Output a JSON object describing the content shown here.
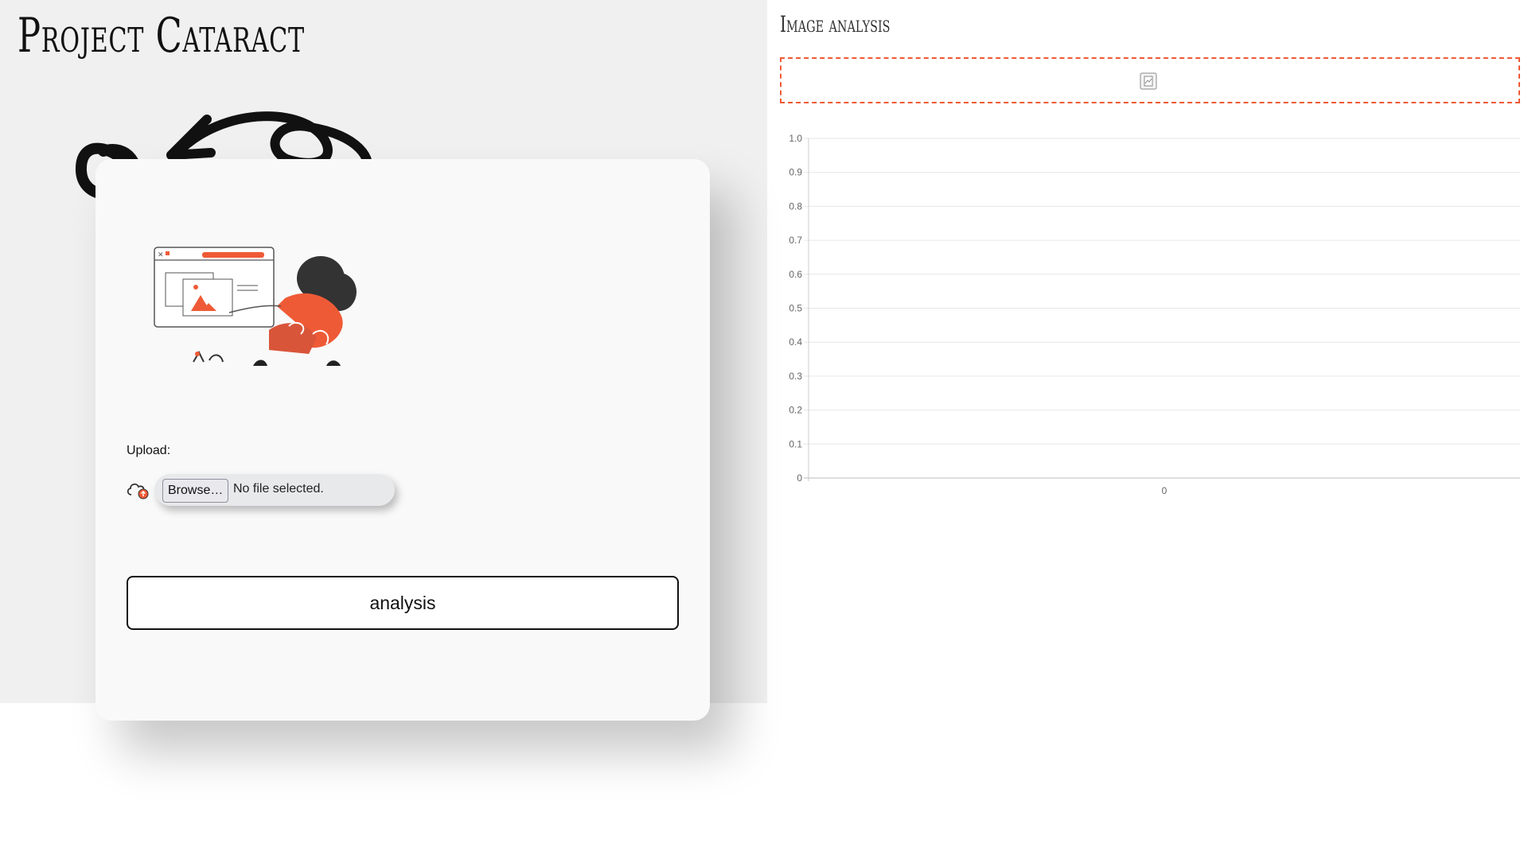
{
  "header": {
    "title": "Project Cataract"
  },
  "upload": {
    "label": "Upload:",
    "browse_label": "Browse…",
    "file_status": "No file selected."
  },
  "actions": {
    "analysis_label": "analysis"
  },
  "results": {
    "title": "Image analysis"
  },
  "colors": {
    "accent": "#ef5a36",
    "panel": "#f0f0f0",
    "card": "#f9f9f9"
  },
  "icons": {
    "upload": "cloud-upload-icon",
    "image": "broken-image-icon"
  },
  "chart_data": {
    "type": "bar",
    "categories": [
      "0"
    ],
    "values": [],
    "ylim": [
      0,
      1.0
    ],
    "yticks": [
      "0",
      "0.1",
      "0.2",
      "0.3",
      "0.4",
      "0.5",
      "0.6",
      "0.7",
      "0.8",
      "0.9",
      "1.0"
    ],
    "grid": true
  }
}
